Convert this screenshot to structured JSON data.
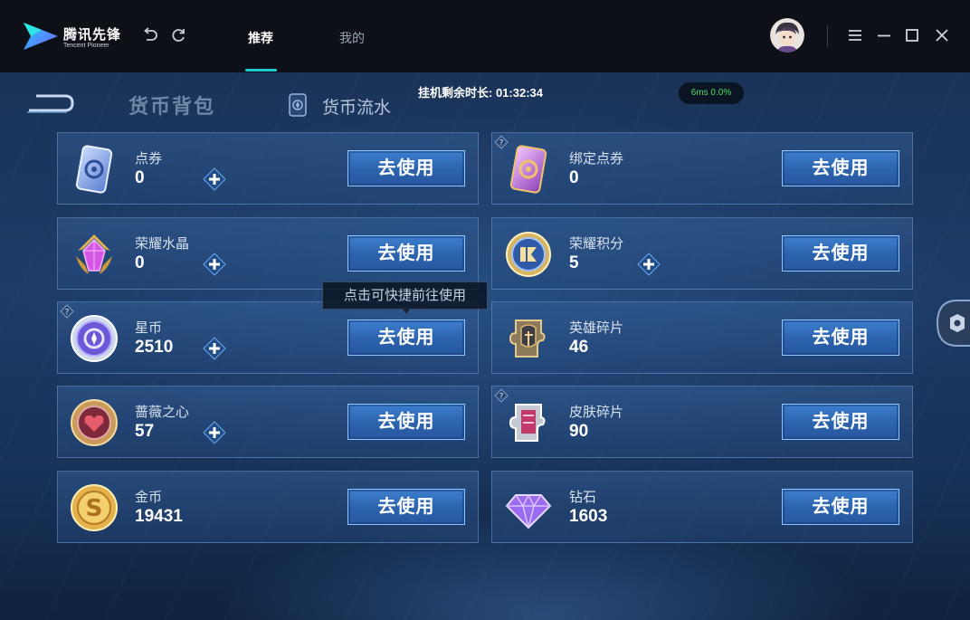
{
  "app": {
    "logo_title": "腾讯先锋",
    "logo_subtitle": "Tencent Pioneer",
    "tabs": [
      {
        "label": "推荐",
        "active": true
      },
      {
        "label": "我的",
        "active": false
      }
    ],
    "accent_color": "#1ec9d4",
    "icons": {
      "undo": "undo-icon",
      "refresh": "refresh-icon",
      "menu": "menu-icon",
      "minimize": "minimize-icon",
      "maximize": "maximize-icon",
      "close": "close-icon"
    }
  },
  "game": {
    "header": {
      "title": "货币背包",
      "flow_tab_label": "货币流水"
    },
    "hang_timer": "挂机剩余时长: 01:32:34",
    "ping": "6ms  0.0%",
    "tooltip": "点击可快捷前往使用",
    "use_label": "去使用",
    "items": [
      {
        "name": "点券",
        "count": "0",
        "icon": "voucher-card-icon",
        "plus": true,
        "help": false
      },
      {
        "name": "绑定点券",
        "count": "0",
        "icon": "bound-voucher-card-icon",
        "plus": false,
        "help": true
      },
      {
        "name": "荣耀水晶",
        "count": "0",
        "icon": "glory-crystal-icon",
        "plus": true,
        "help": false
      },
      {
        "name": "荣耀积分",
        "count": "5",
        "icon": "glory-points-icon",
        "plus": true,
        "help": false
      },
      {
        "name": "星币",
        "count": "2510",
        "icon": "star-coin-icon",
        "plus": true,
        "help": true
      },
      {
        "name": "英雄碎片",
        "count": "46",
        "icon": "hero-fragment-icon",
        "plus": false,
        "help": false
      },
      {
        "name": "蔷薇之心",
        "count": "57",
        "icon": "rose-heart-icon",
        "plus": true,
        "help": false
      },
      {
        "name": "皮肤碎片",
        "count": "90",
        "icon": "skin-fragment-icon",
        "plus": false,
        "help": true
      },
      {
        "name": "金币",
        "count": "19431",
        "icon": "gold-coin-icon",
        "plus": false,
        "help": false
      },
      {
        "name": "钻石",
        "count": "1603",
        "icon": "diamond-icon",
        "plus": false,
        "help": false
      }
    ]
  }
}
